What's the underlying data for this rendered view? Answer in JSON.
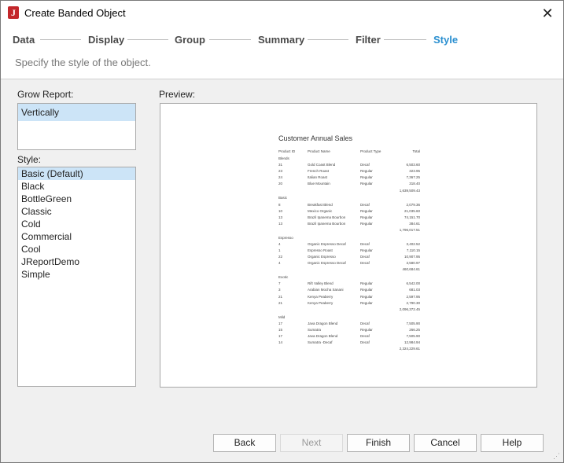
{
  "window": {
    "title": "Create Banded Object",
    "app_icon_letter": "J"
  },
  "steps": [
    {
      "label": "Data",
      "active": false
    },
    {
      "label": "Display",
      "active": false
    },
    {
      "label": "Group",
      "active": false
    },
    {
      "label": "Summary",
      "active": false
    },
    {
      "label": "Filter",
      "active": false
    },
    {
      "label": "Style",
      "active": true
    }
  ],
  "subtitle": "Specify the style of the object.",
  "grow_report": {
    "label": "Grow Report:",
    "options": [
      "Vertically"
    ],
    "selected": "Vertically"
  },
  "style": {
    "label": "Style:",
    "options": [
      "Basic (Default)",
      "Black",
      "BottleGreen",
      "Classic",
      "Cold",
      "Commercial",
      "Cool",
      "JReportDemo",
      "Simple"
    ],
    "selected": "Basic (Default)"
  },
  "preview": {
    "label": "Preview:",
    "report": {
      "title": "Customer Annual Sales",
      "headers": [
        "Product ID",
        "Product Name",
        "Product Type",
        "Total"
      ],
      "rows": [
        {
          "kind": "group",
          "text": "Blends"
        },
        {
          "kind": "detail",
          "cells": [
            "31",
            "Gold Coast Blend",
            "Decaf",
            "6,503.60"
          ]
        },
        {
          "kind": "detail",
          "cells": [
            "23",
            "French Roast",
            "Regular",
            "323.95"
          ]
        },
        {
          "kind": "detail",
          "cells": [
            "24",
            "Italian Roast",
            "Regular",
            "7,367.25"
          ]
        },
        {
          "kind": "detail",
          "cells": [
            "20",
            "Blue Mountain",
            "Regular",
            "318.40"
          ]
        },
        {
          "kind": "total",
          "text": "1,639,509.43"
        },
        {
          "kind": "group",
          "text": "Basic"
        },
        {
          "kind": "detail",
          "cells": [
            "8",
            "Breakfast Blend",
            "Decaf",
            "2,079.36"
          ]
        },
        {
          "kind": "detail",
          "cells": [
            "10",
            "Mexico Organic",
            "Regular",
            "21,035.60"
          ]
        },
        {
          "kind": "detail",
          "cells": [
            "13",
            "Brazil Ipanema Bourbon",
            "Regular",
            "74,151.70"
          ]
        },
        {
          "kind": "detail",
          "cells": [
            "13",
            "Brazil Ipanema Bourbon",
            "Regular",
            "384.61"
          ]
        },
        {
          "kind": "total",
          "text": "1,796,017.51"
        },
        {
          "kind": "group",
          "text": "Espresso"
        },
        {
          "kind": "detail",
          "cells": [
            "4",
            "Organic Espresso Decaf",
            "Decaf",
            "3,402.52"
          ]
        },
        {
          "kind": "detail",
          "cells": [
            "1",
            "Espresso Roast",
            "Regular",
            "7,110.15"
          ]
        },
        {
          "kind": "detail",
          "cells": [
            "22",
            "Organic Espresso",
            "Decaf",
            "10,907.95"
          ]
        },
        {
          "kind": "detail",
          "cells": [
            "4",
            "Organic Espresso Decaf",
            "Decaf",
            "3,580.97"
          ]
        },
        {
          "kind": "total",
          "text": "460,684.61"
        },
        {
          "kind": "group",
          "text": "Exotic"
        },
        {
          "kind": "detail",
          "cells": [
            "7",
            "Rift Valley Blend",
            "Regular",
            "6,542.00"
          ]
        },
        {
          "kind": "detail",
          "cells": [
            "3",
            "Arabian Mocha Sanani",
            "Regular",
            "681.03"
          ]
        },
        {
          "kind": "detail",
          "cells": [
            "21",
            "Kenya Peaberry",
            "Regular",
            "2,597.95"
          ]
        },
        {
          "kind": "detail",
          "cells": [
            "21",
            "Kenya Peaberry",
            "Regular",
            "2,790.30"
          ]
        },
        {
          "kind": "total",
          "text": "2,096,372.45"
        },
        {
          "kind": "group",
          "text": "Mild"
        },
        {
          "kind": "detail",
          "cells": [
            "17",
            "Java Dragon Blend",
            "Decaf",
            "7,505.90"
          ]
        },
        {
          "kind": "detail",
          "cells": [
            "15",
            "Sumatra",
            "Regular",
            "266.25"
          ]
        },
        {
          "kind": "detail",
          "cells": [
            "17",
            "Java Dragon Blend",
            "Decaf",
            "7,505.90"
          ]
        },
        {
          "kind": "detail",
          "cells": [
            "14",
            "Sumatra -Decaf",
            "Decaf",
            "12,984.94"
          ]
        },
        {
          "kind": "total",
          "text": "2,324,229.61"
        }
      ]
    }
  },
  "buttons": {
    "back": "Back",
    "next": "Next",
    "finish": "Finish",
    "cancel": "Cancel",
    "help": "Help"
  },
  "icons": {
    "close": "close-icon",
    "app": "app-icon",
    "grip": "resize-grip-icon"
  },
  "colors": {
    "active_step": "#2a8fd0",
    "selection": "#cce4f7"
  }
}
